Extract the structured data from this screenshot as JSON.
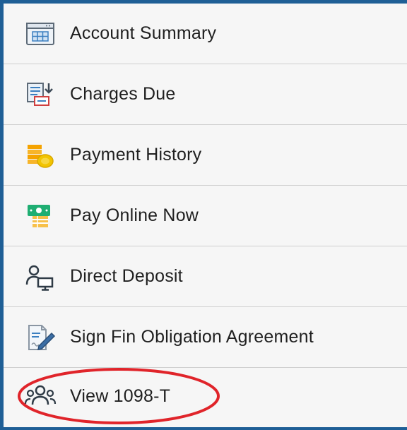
{
  "menu": {
    "items": [
      {
        "label": "Account Summary",
        "icon": "table-icon"
      },
      {
        "label": "Charges Due",
        "icon": "invoice-download-icon"
      },
      {
        "label": "Payment History",
        "icon": "coins-icon"
      },
      {
        "label": "Pay Online Now",
        "icon": "cash-payment-icon"
      },
      {
        "label": "Direct Deposit",
        "icon": "person-computer-icon"
      },
      {
        "label": "Sign Fin Obligation Agreement",
        "icon": "sign-document-icon"
      },
      {
        "label": "View 1098-T",
        "icon": "people-group-icon"
      }
    ]
  },
  "colors": {
    "border": "#1f5f96",
    "annotation": "#e0242a",
    "background": "#f6f6f6"
  }
}
